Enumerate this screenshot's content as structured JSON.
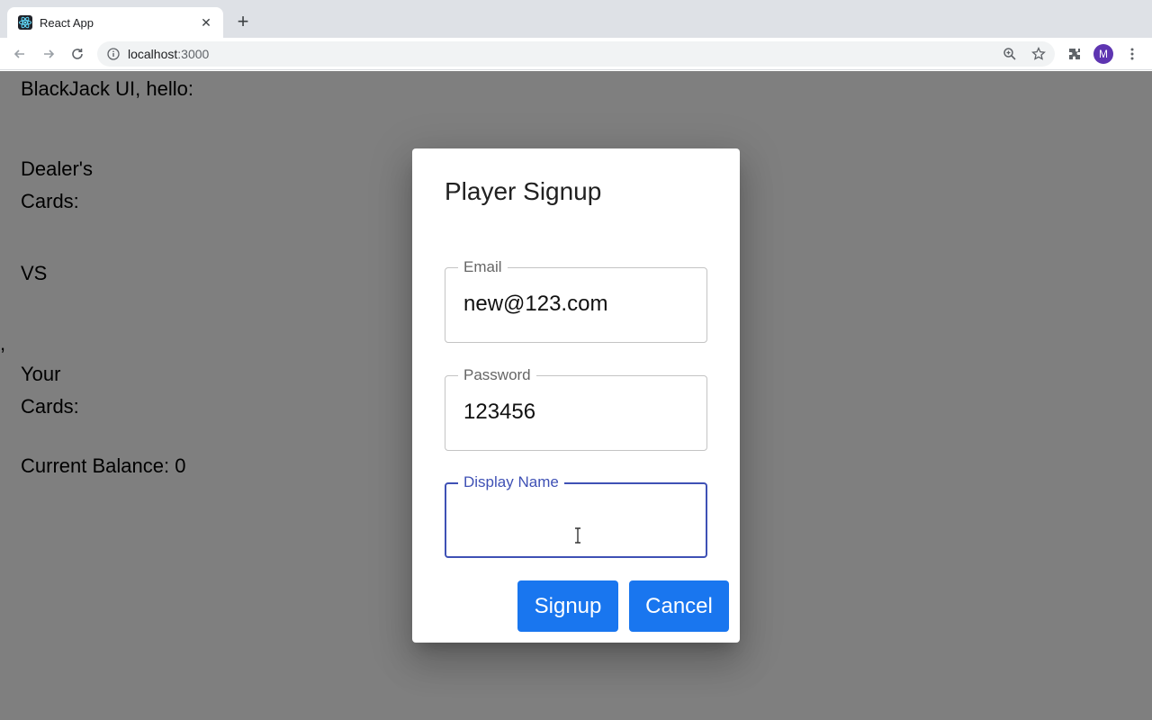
{
  "browser": {
    "tab_title": "React App",
    "url_host": "localhost",
    "url_port": ":3000",
    "profile_initial": "M"
  },
  "page": {
    "heading": "BlackJack UI, hello:",
    "dealer_label_1": "Dealer's",
    "dealer_label_2": "Cards:",
    "vs": "VS",
    "stray_comma": ",",
    "your_label_1": "Your",
    "your_label_2": "Cards:",
    "balance": "Current Balance: 0"
  },
  "dialog": {
    "title": "Player Signup",
    "email_label": "Email",
    "email_value": "new@123.com",
    "password_label": "Password",
    "password_value": "123456",
    "display_name_label": "Display Name",
    "display_name_value": "",
    "signup_label": "Signup",
    "cancel_label": "Cancel"
  },
  "colors": {
    "primary_button": "#1976ef",
    "focus": "#3f51b5"
  }
}
